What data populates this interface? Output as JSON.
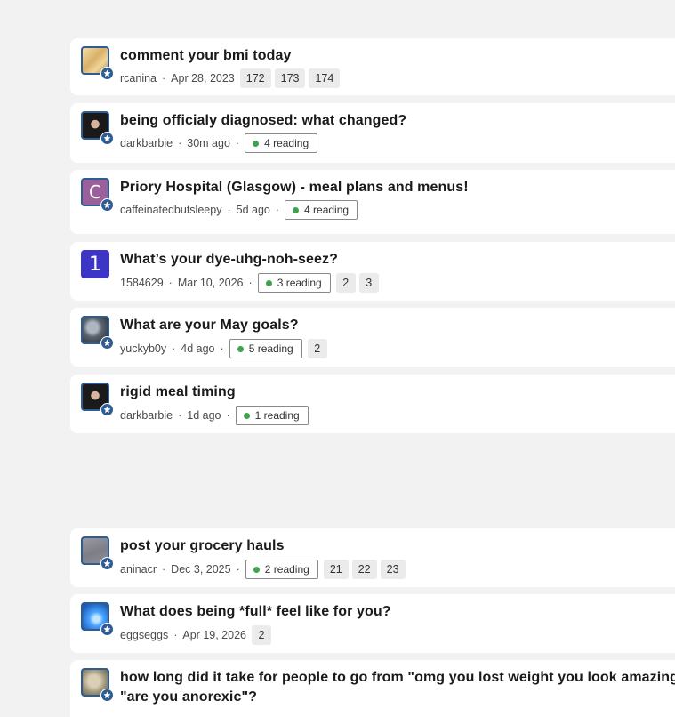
{
  "threads": [
    {
      "title": "comment your bmi today",
      "author": "rcanina",
      "time": "Apr 28, 2023",
      "reading": "",
      "pages": [
        "172",
        "173",
        "174"
      ],
      "avatar": {
        "kind": "image",
        "colors": [
          "#e8c98a",
          "#c9a25a"
        ]
      }
    },
    {
      "title": "being officialy diagnosed: what changed?",
      "author": "darkbarbie",
      "time": "30m ago",
      "reading": "4 reading",
      "pages": [],
      "avatar": {
        "kind": "image",
        "colors": [
          "#1a1a1a",
          "#c9a08a"
        ]
      }
    },
    {
      "title": "Priory Hospital (Glasgow) - meal plans and menus!",
      "author": "caffeinatedbutsleepy",
      "time": "5d ago",
      "reading": "4 reading",
      "pages": [],
      "avatar": {
        "kind": "letter",
        "letter": "C",
        "colors": [
          "#9b5f9b"
        ]
      }
    },
    {
      "title": "What’s your dye-uhg-noh-seez?",
      "author": "1584629",
      "time": "Mar 10, 2026",
      "reading": "3 reading",
      "pages": [
        "2",
        "3"
      ],
      "avatar": {
        "kind": "letter",
        "letter": "1",
        "colors": [
          "#3d35c6"
        ]
      }
    },
    {
      "title": "What are your May goals?",
      "author": "yuckyb0y",
      "time": "4d ago",
      "reading": "5 reading",
      "pages": [
        "2"
      ],
      "avatar": {
        "kind": "image",
        "colors": [
          "#6e7a86",
          "#2b2f36"
        ]
      }
    },
    {
      "title": "rigid meal timing",
      "author": "darkbarbie",
      "time": "1d ago",
      "reading": "1 reading",
      "pages": [],
      "avatar": {
        "kind": "image",
        "colors": [
          "#1a1a1a",
          "#c9a08a"
        ]
      }
    },
    {
      "title": "post your grocery hauls",
      "author": "aninacr",
      "time": "Dec 3, 2025",
      "reading": "2 reading",
      "pages": [
        "21",
        "22",
        "23"
      ],
      "avatar": {
        "kind": "image",
        "colors": [
          "#8e8e96",
          "#6f6f78"
        ]
      }
    },
    {
      "title": "What does being *full* feel like for you?",
      "author": "eggseggs",
      "time": "Apr 19, 2026",
      "reading": "",
      "pages": [
        "2"
      ],
      "avatar": {
        "kind": "image",
        "colors": [
          "#2f7fd6",
          "#8fd0ff"
        ]
      }
    },
    {
      "title": "how long did it take for people to go from \"omg you lost weight you look amazing",
      "title2": "\"are you anorexic\"?",
      "author": "",
      "time": "",
      "reading": "",
      "pages": [],
      "avatar": {
        "kind": "image",
        "colors": [
          "#b7aa8a",
          "#6b6a5a"
        ]
      }
    }
  ]
}
